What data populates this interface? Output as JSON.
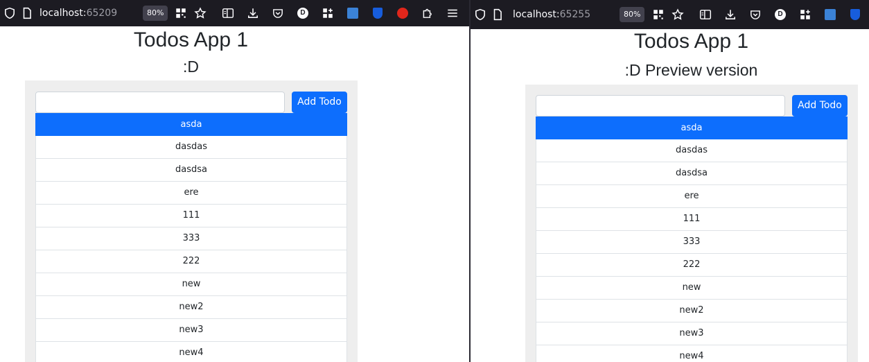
{
  "left_window": {
    "browser": {
      "url_host": "localhost:",
      "url_port": "65209",
      "zoom": "80%"
    },
    "app": {
      "title": "Todos App 1",
      "subtitle": ":D",
      "input_value": "",
      "add_button_label": "Add Todo",
      "todos": [
        {
          "label": "asda",
          "active": true
        },
        {
          "label": "dasdas",
          "active": false
        },
        {
          "label": "dasdsa",
          "active": false
        },
        {
          "label": "ere",
          "active": false
        },
        {
          "label": "111",
          "active": false
        },
        {
          "label": "333",
          "active": false
        },
        {
          "label": "222",
          "active": false
        },
        {
          "label": "new",
          "active": false
        },
        {
          "label": "new2",
          "active": false
        },
        {
          "label": "new3",
          "active": false
        },
        {
          "label": "new4",
          "active": false
        }
      ]
    }
  },
  "right_window": {
    "browser": {
      "url_host": "localhost:",
      "url_port": "65255",
      "zoom": "80%"
    },
    "app": {
      "title": "Todos App 1",
      "subtitle": ":D Preview version",
      "input_value": "",
      "add_button_label": "Add Todo",
      "todos": [
        {
          "label": "asda",
          "active": true
        },
        {
          "label": "dasdas",
          "active": false
        },
        {
          "label": "dasdsa",
          "active": false
        },
        {
          "label": "ere",
          "active": false
        },
        {
          "label": "111",
          "active": false
        },
        {
          "label": "333",
          "active": false
        },
        {
          "label": "222",
          "active": false
        },
        {
          "label": "new",
          "active": false
        },
        {
          "label": "new2",
          "active": false
        },
        {
          "label": "new3",
          "active": false
        },
        {
          "label": "new4",
          "active": false
        }
      ]
    }
  },
  "toolbar_icons": [
    "shield-icon",
    "page-icon",
    "qr-code-icon",
    "bookmark-star-icon",
    "reader-view-icon",
    "download-icon",
    "pocket-icon",
    "duckduckgo-icon",
    "extensions-grid-icon",
    "translate-icon",
    "bitwarden-icon",
    "stop-hand-icon",
    "puzzle-icon",
    "menu-icon"
  ],
  "colors": {
    "toolbar_bg": "#1c1b22",
    "accent": "#0d6efd",
    "panel_bg": "#eeeeee",
    "page_bg": "#ffffff"
  }
}
